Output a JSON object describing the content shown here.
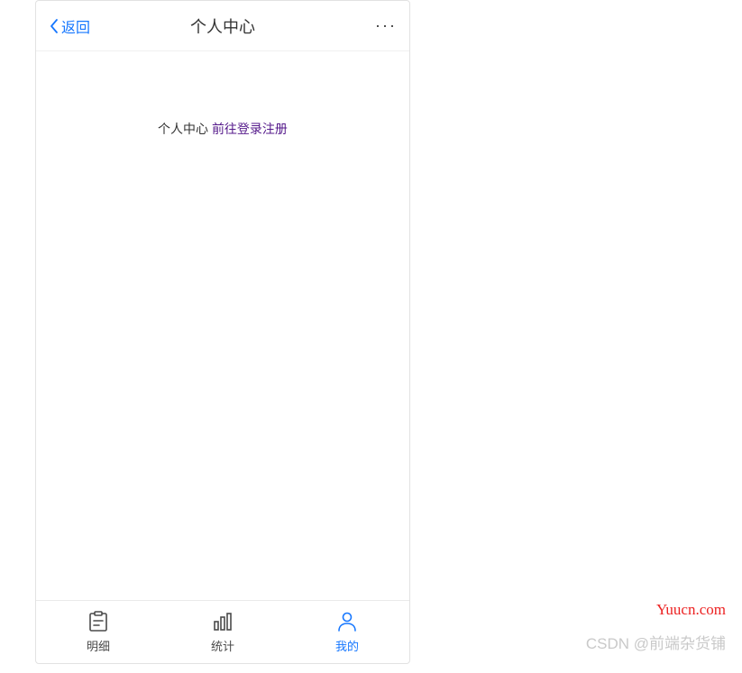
{
  "nav": {
    "back_label": "返回",
    "title": "个人中心",
    "more": "···"
  },
  "content": {
    "label": "个人中心 ",
    "link_text": "前往登录注册"
  },
  "tabs": [
    {
      "label": "明细"
    },
    {
      "label": "统计"
    },
    {
      "label": "我的"
    }
  ],
  "watermark": {
    "site": "Yuucn.com",
    "credit": "CSDN @前端杂货铺"
  }
}
